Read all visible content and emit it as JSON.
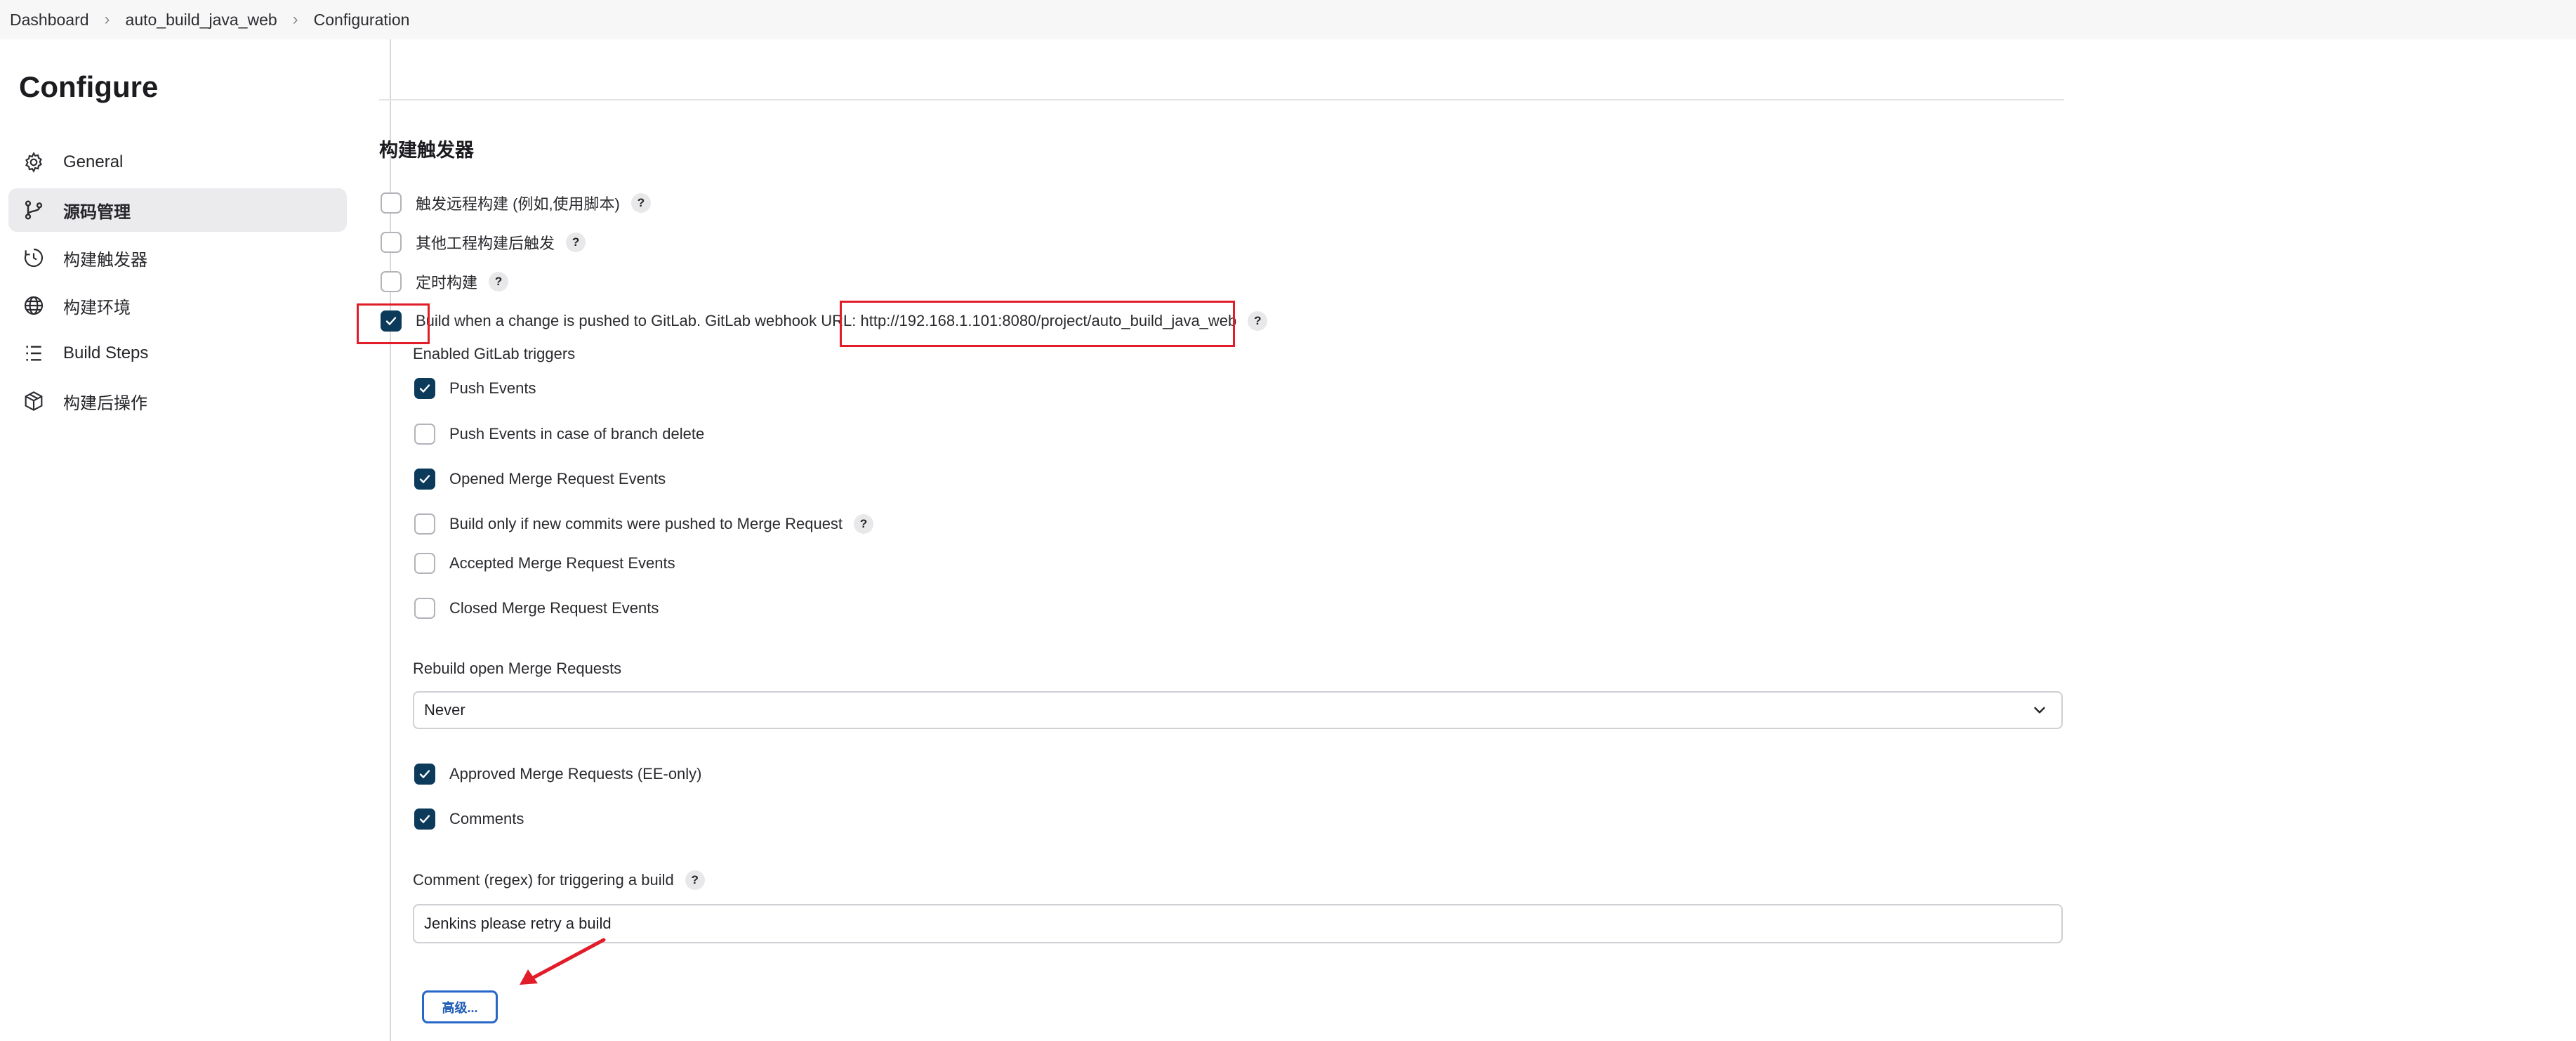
{
  "breadcrumb": {
    "items": [
      "Dashboard",
      "auto_build_java_web",
      "Configuration"
    ],
    "separator": "›"
  },
  "page": {
    "title": "Configure"
  },
  "sidebar": {
    "items": [
      {
        "label": "General",
        "icon": "gear-icon",
        "active": false
      },
      {
        "label": "源码管理",
        "icon": "branch-icon",
        "active": true
      },
      {
        "label": "构建触发器",
        "icon": "clock-icon",
        "active": false
      },
      {
        "label": "构建环境",
        "icon": "globe-icon",
        "active": false
      },
      {
        "label": "Build Steps",
        "icon": "list-icon",
        "active": false
      },
      {
        "label": "构建后操作",
        "icon": "package-icon",
        "active": false
      }
    ]
  },
  "triggers": {
    "section_title": "构建触发器",
    "remote_build": {
      "label": "触发远程构建 (例如,使用脚本)",
      "checked": false
    },
    "after_other_projects": {
      "label": "其他工程构建后触发",
      "checked": false
    },
    "periodic": {
      "label": "定时构建",
      "checked": false
    },
    "gitlab_push": {
      "label": "Build when a change is pushed to GitLab. GitLab webhook URL: ",
      "url": "http://192.168.1.101:8080/project/auto_build_java_web",
      "checked": true
    },
    "enabled_gitlab_triggers_label": "Enabled GitLab triggers",
    "gitlab_triggers": [
      {
        "label": "Push Events",
        "checked": true,
        "help": false
      },
      {
        "label": "Push Events in case of branch delete",
        "checked": false,
        "help": false
      },
      {
        "label": "Opened Merge Request Events",
        "checked": true,
        "help": false
      },
      {
        "label": "Build only if new commits were pushed to Merge Request",
        "checked": false,
        "help": true
      },
      {
        "label": "Accepted Merge Request Events",
        "checked": false,
        "help": false
      },
      {
        "label": "Closed Merge Request Events",
        "checked": false,
        "help": false
      }
    ],
    "rebuild_label": "Rebuild open Merge Requests",
    "rebuild_value": "Never",
    "approved_mr": {
      "label": "Approved Merge Requests (EE-only)",
      "checked": true
    },
    "comments": {
      "label": "Comments",
      "checked": true
    },
    "comment_regex_label": "Comment (regex) for triggering a build",
    "comment_regex_value": "Jenkins please retry a build",
    "advanced_button": "高级..."
  },
  "help_glyph": "?",
  "colors": {
    "checkbox_checked": "#0c3a5b",
    "annotation_red": "#e11d2a",
    "button_blue": "#2767c7"
  }
}
